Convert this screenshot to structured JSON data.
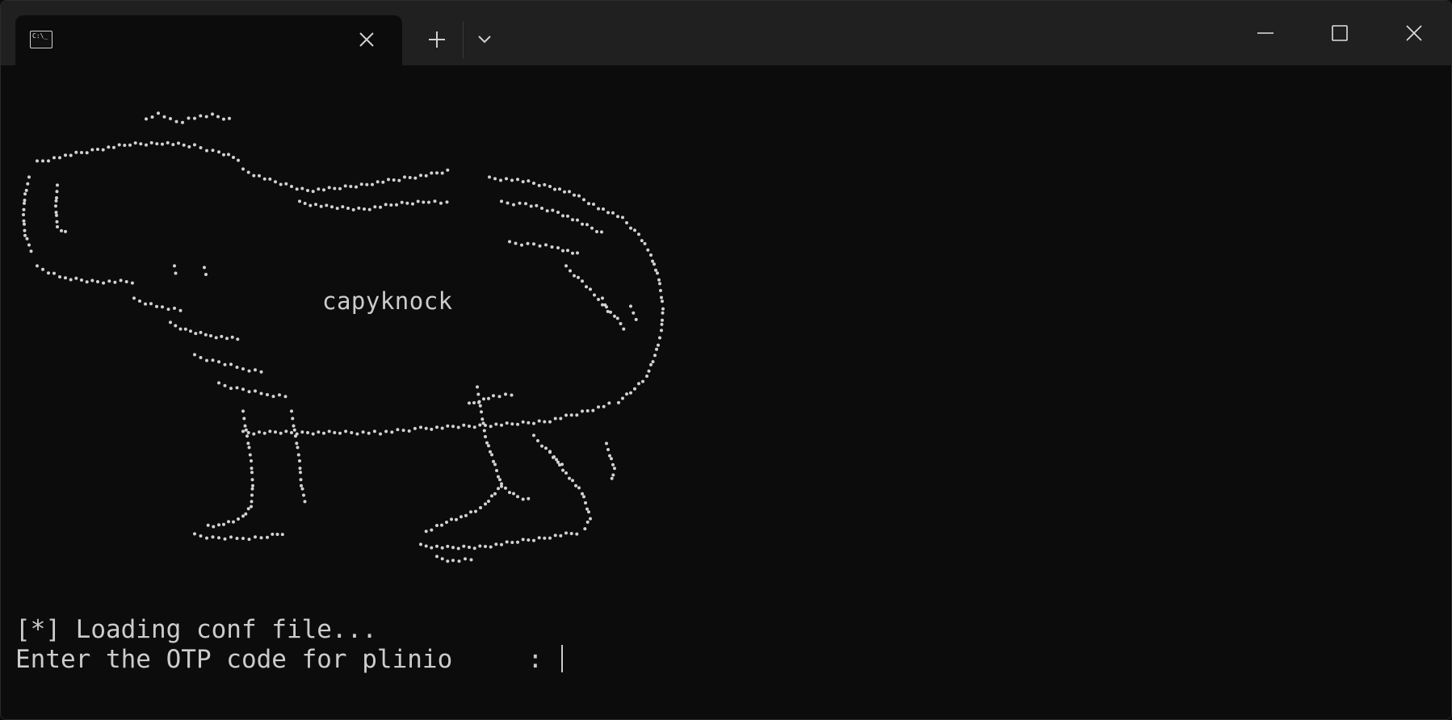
{
  "window": {
    "tab_icon_glyph": "C:\\_",
    "icons": {
      "tab_icon": "terminal-icon",
      "tab_close": "close-icon",
      "new_tab": "plus-icon",
      "dropdown": "chevron-down-icon",
      "minimize": "minimize-icon",
      "maximize": "maximize-icon",
      "close": "close-icon"
    }
  },
  "terminal": {
    "banner": "capyknock",
    "line1": "[*] Loading conf file...",
    "line2": "Enter the OTP code for plinio     : "
  },
  "colors": {
    "background": "#0c0c0c",
    "titlebar": "#202020",
    "text": "#cccccc"
  }
}
